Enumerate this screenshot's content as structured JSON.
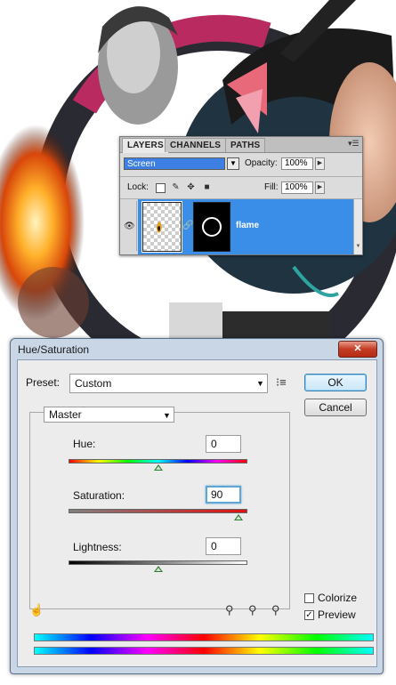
{
  "colors": {
    "selection": "#3b8ee8",
    "dialog_frame": "#c9d6e6",
    "accent_red": "#c02050",
    "close_red": "#c43b24"
  },
  "layers_panel": {
    "tabs": [
      "LAYERS",
      "CHANNELS",
      "PATHS"
    ],
    "blend_mode": "Screen",
    "opacity_label": "Opacity:",
    "opacity_value": "100%",
    "lock_label": "Lock:",
    "fill_label": "Fill:",
    "fill_value": "100%",
    "layer_name": "flame"
  },
  "dialog": {
    "title": "Hue/Saturation",
    "close_glyph": "✕",
    "preset_label": "Preset:",
    "preset_value": "Custom",
    "ok_label": "OK",
    "cancel_label": "Cancel",
    "channel_value": "Master",
    "hue_label": "Hue:",
    "hue_value": "0",
    "saturation_label": "Saturation:",
    "saturation_value": "90",
    "lightness_label": "Lightness:",
    "lightness_value": "0",
    "colorize_label": "Colorize",
    "colorize_checked": false,
    "preview_label": "Preview",
    "preview_checked": true,
    "hue_range": [
      -180,
      180
    ],
    "saturation_range": [
      -100,
      100
    ],
    "lightness_range": [
      -100,
      100
    ]
  }
}
